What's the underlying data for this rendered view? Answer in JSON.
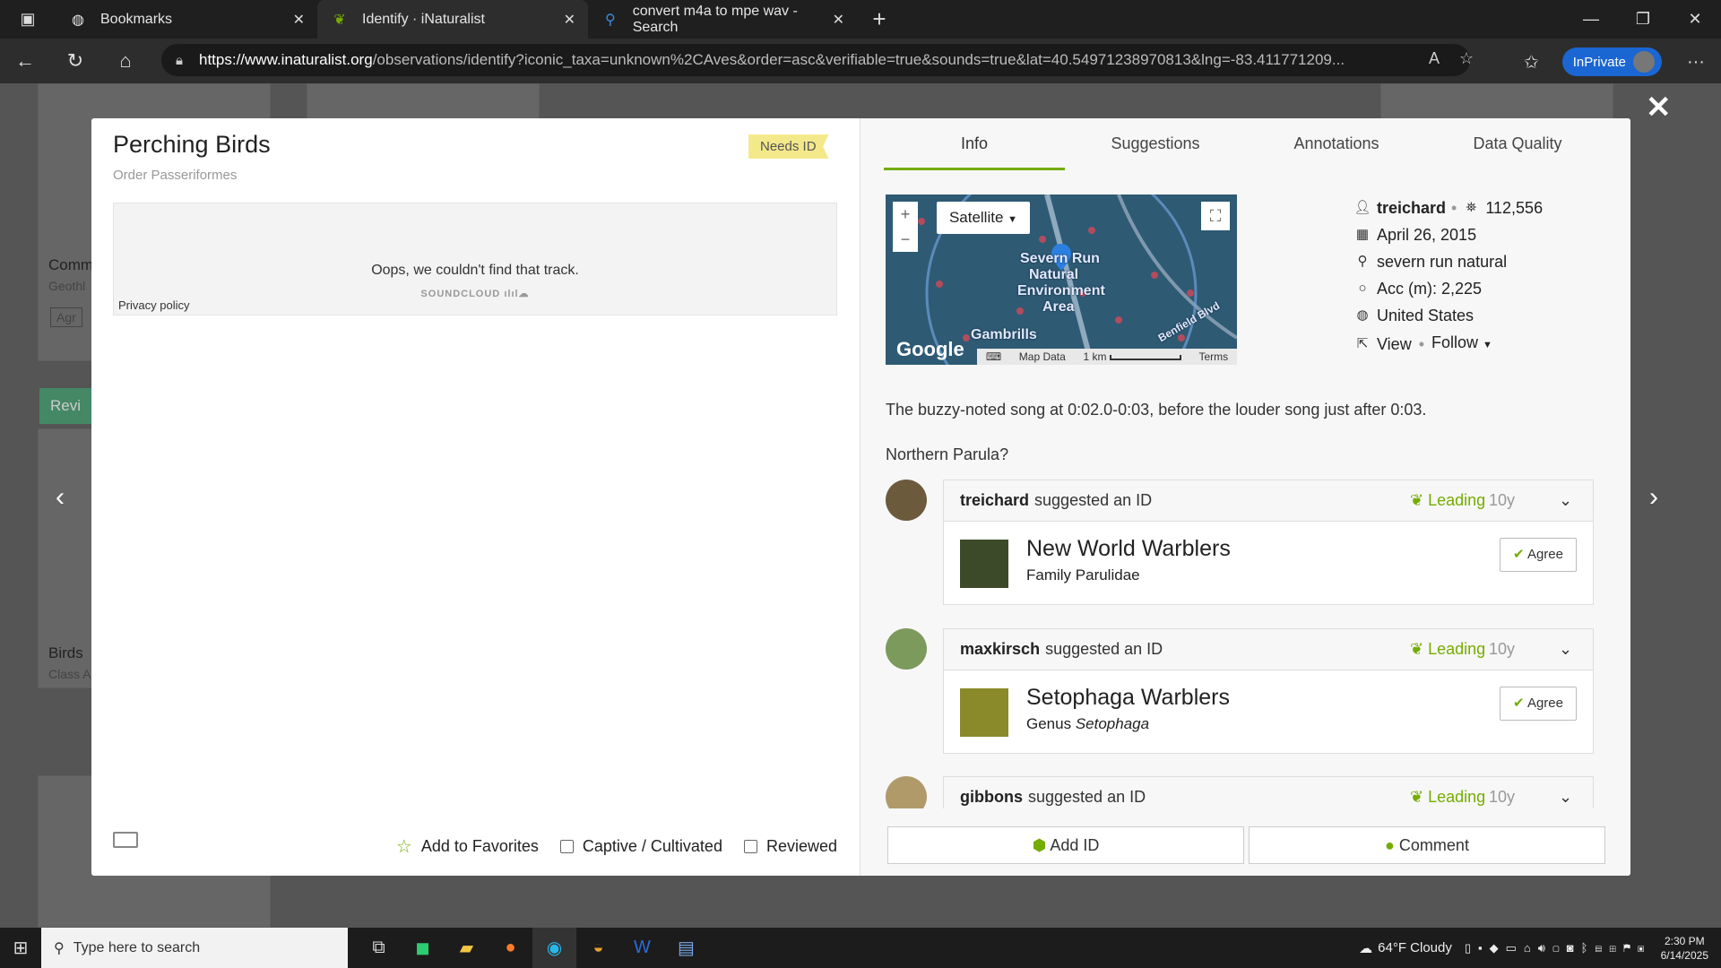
{
  "browser": {
    "tabs": [
      {
        "title": "Bookmarks",
        "icon": "globe-icon"
      },
      {
        "title": "Identify · iNaturalist",
        "icon": "inaturalist-leaf-icon"
      },
      {
        "title": "convert m4a to mpe wav - Search",
        "icon": "search-icon"
      }
    ],
    "url_domain": "https://www.inaturalist.org",
    "url_path": "/observations/identify?iconic_taxa=unknown%2CAves&order=asc&verifiable=true&sounds=true&lat=40.54971238970813&lng=-83.411771209...",
    "inprivate_label": "InPrivate"
  },
  "background": {
    "card1_title": "Comm",
    "card1_sub": "Geothl",
    "card1_agree": "Agr",
    "review_label": "Revi",
    "card2_title": "Birds",
    "card2_sub": "Class A"
  },
  "observation": {
    "title": "Perching Birds",
    "subtitle": "Order Passeriformes",
    "status": "Needs ID",
    "embed_message": "Oops, we couldn't find that track.",
    "embed_brand": "SOUNDCLOUD",
    "privacy_label": "Privacy policy",
    "footer": {
      "favorites": "Add to Favorites",
      "captive": "Captive / Cultivated",
      "reviewed": "Reviewed"
    }
  },
  "panel": {
    "tabs": [
      "Info",
      "Suggestions",
      "Annotations",
      "Data Quality"
    ],
    "active_tab": "Info",
    "map": {
      "type_label": "Satellite",
      "place_label_1": "Severn Run",
      "place_label_2": "Natural",
      "place_label_3": "Environment",
      "place_label_4": "Area",
      "place_label_5": "Gambrills",
      "place_label_6": "Benfield Blvd",
      "google": "Google",
      "map_data": "Map Data",
      "scale": "1 km",
      "terms": "Terms"
    },
    "meta": {
      "user": "treichard",
      "observations": "112,556",
      "date": "April 26, 2015",
      "place": "severn run natural",
      "accuracy": "Acc (m): 2,225",
      "country": "United States",
      "view": "View",
      "follow": "Follow"
    },
    "description": [
      "The buzzy-noted song at 0:02.0-0:03, before the louder song just after 0:03.",
      "Northern Parula?"
    ],
    "identifications": [
      {
        "user": "treichard",
        "action": "suggested an ID",
        "status": "Leading",
        "age": "10y",
        "taxon": "New World Warblers",
        "rank_label": "Family Parulidae",
        "agree": "Agree"
      },
      {
        "user": "maxkirsch",
        "action": "suggested an ID",
        "status": "Leading",
        "age": "10y",
        "taxon": "Setophaga Warblers",
        "rank_label": "Genus",
        "rank_name": "Setophaga",
        "agree": "Agree"
      },
      {
        "user": "gibbons",
        "action": "suggested an ID",
        "status": "Leading",
        "age": "10y"
      }
    ],
    "add_id": "Add ID",
    "comment": "Comment"
  },
  "taskbar": {
    "search_placeholder": "Type here to search",
    "weather": "64°F  Cloudy",
    "time": "2:30 PM",
    "date": "6/14/2025"
  }
}
